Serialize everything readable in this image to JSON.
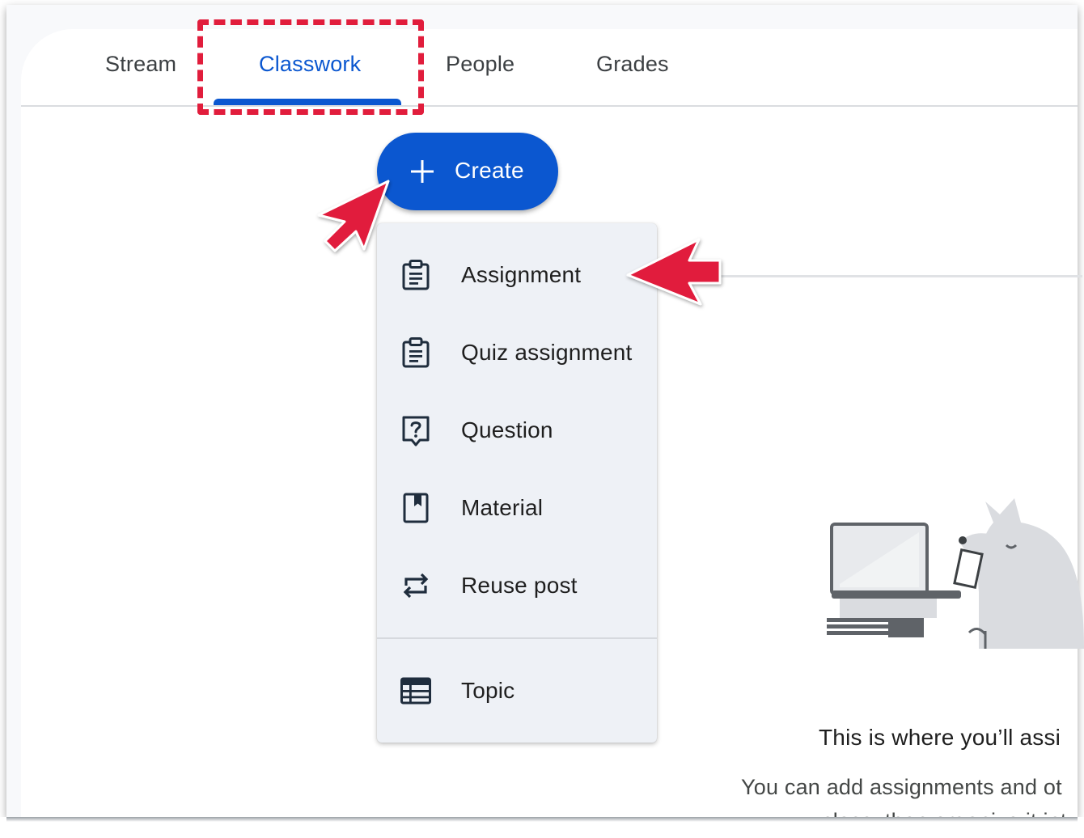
{
  "tabs": [
    {
      "label": "Stream",
      "active": false
    },
    {
      "label": "Classwork",
      "active": true
    },
    {
      "label": "People",
      "active": false
    },
    {
      "label": "Grades",
      "active": false
    }
  ],
  "create_button": {
    "label": "Create",
    "icon": "plus-icon"
  },
  "create_menu": {
    "items": [
      {
        "label": "Assignment",
        "icon": "assignment-icon"
      },
      {
        "label": "Quiz assignment",
        "icon": "quiz-assignment-icon"
      },
      {
        "label": "Question",
        "icon": "question-icon"
      },
      {
        "label": "Material",
        "icon": "material-icon"
      },
      {
        "label": "Reuse post",
        "icon": "reuse-icon"
      },
      {
        "label": "Topic",
        "icon": "topic-icon"
      }
    ]
  },
  "empty_state": {
    "title": "This is where you’ll assi",
    "body_line1": "You can add assignments and ot",
    "body_line2": "class, then organize it int"
  },
  "colors": {
    "accent": "#0b57d0",
    "annotation": "#e11d3c",
    "menu_bg": "#eef1f6",
    "text": "#1f1f1f"
  }
}
